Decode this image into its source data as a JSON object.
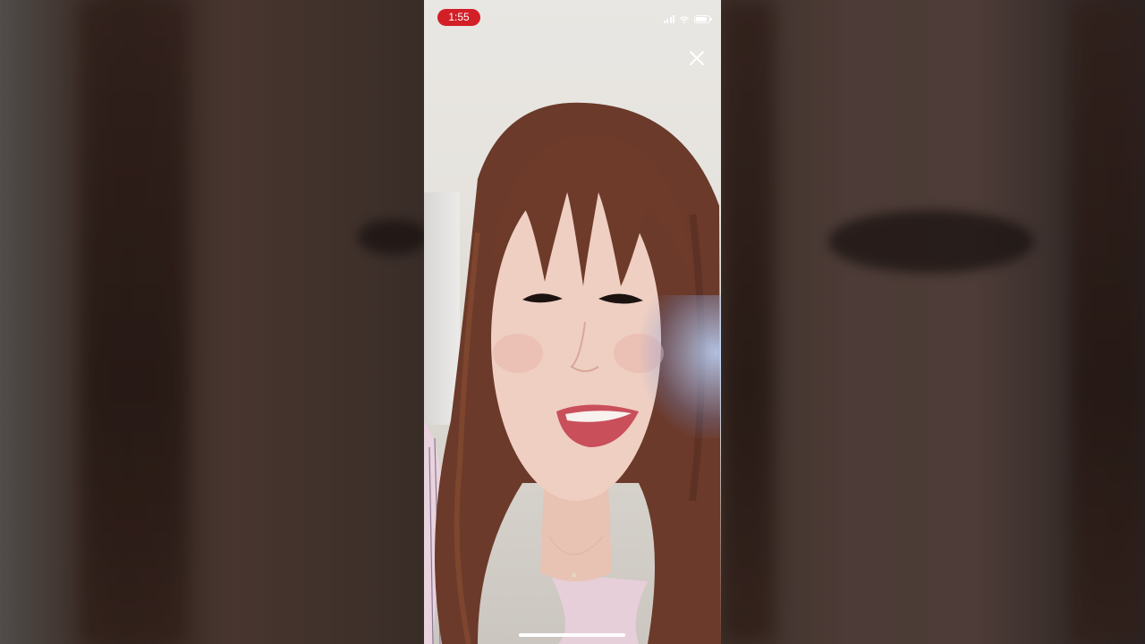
{
  "status_bar": {
    "time": "1:55",
    "time_pill_color": "#d31f26",
    "icons": [
      "signal-icon",
      "wifi-icon",
      "battery-icon"
    ]
  },
  "controls": {
    "close_icon": "close-icon"
  }
}
